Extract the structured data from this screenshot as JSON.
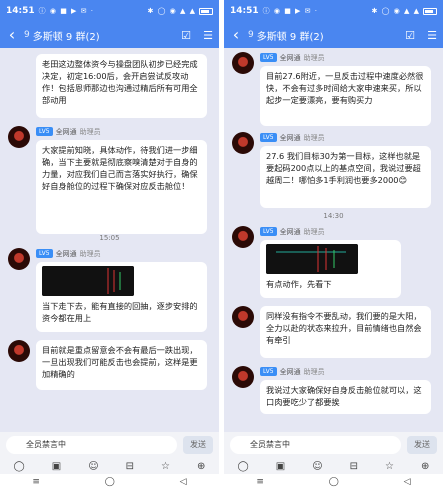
{
  "colors": {
    "header": "#4a86f0",
    "chat_bg": "#e5e7f3",
    "badge": "#3a8ef6"
  },
  "left": {
    "status": {
      "time": "14:51",
      "notif_icons": "ⓘ ◉ ■ ▶ ✉ ·",
      "sys_icons": "✱ ◯ ◉ ▲ ▲"
    },
    "header": {
      "tag": "9",
      "title": "多斯顿 9 群(2)"
    },
    "messages": [
      {
        "text": "老田这边整体资今与操盘团队初步已经完成决定，初定16:00后，会开启尝试反攻动作！包括恩师那边也沟通过精后所有可用全部动用"
      },
      {
        "badge": "LV5",
        "sender": "全网通",
        "role": "助理员",
        "text": "大家提前知晓，具体动作，待我们进一步细确，当下主要就是彻底察嗅清楚对于自身的力量，对应我们自己而言落实好执行，确保好自身舱位的过程下确保对应反击舱位！"
      },
      {
        "time": "15:05"
      },
      {
        "badge": "LV5",
        "sender": "全网通",
        "role": "助理员",
        "text": "当下走下去，能有直接的回抽，逐步安排的资今都在用上"
      },
      {
        "text": "目前就是重点留意会不会有最后一跌出现，一旦出现我们可能反击也会提前，这样是更加精确的"
      }
    ],
    "input": {
      "placeholder": "全员禁言中",
      "send": "发送"
    },
    "bottom_icons": [
      "◯",
      "▣",
      "☺",
      "⊟",
      "☆",
      "⊕"
    ],
    "nav": [
      "≡",
      "◯",
      "◁"
    ]
  },
  "right": {
    "status": {
      "time": "14:51",
      "notif_icons": "ⓘ ◉ ■ ▶ ✉ ·",
      "sys_icons": "✱ ◯ ◉ ▲ ▲"
    },
    "header": {
      "tag": "9",
      "title": "多斯顿 9 群(2)"
    },
    "messages": [
      {
        "badge": "LV5",
        "sender": "全网通",
        "role": "助理员",
        "text": "目前27.6附近，一旦反击过程中速度必然很快，不会有过多时间给大家申速来买，所以起步一定要漂亮，要有购买力"
      },
      {
        "badge": "LV5",
        "sender": "全网通",
        "role": "助理员",
        "text": "27.6 我们目标30为第一目标，这样也就是要起码200点以上的基点空间，我说过要超越周二！哪怕多1手利润也要多2000😊"
      },
      {
        "time": "14:30"
      },
      {
        "badge": "LV5",
        "sender": "全网通",
        "role": "助理员",
        "text": "有点动作，先看下"
      },
      {
        "text": "同样没有指令不要乱动，我们要的是大阳，全力以赴的状态来拉升，目前情绪也自然会有牵引"
      },
      {
        "badge": "LV5",
        "sender": "全网通",
        "role": "助理员",
        "text": "我说过大家确保好自身反击舱位就可以，这口肉要吃少了都要挨"
      }
    ],
    "input": {
      "placeholder": "全员禁言中",
      "send": "发送"
    },
    "bottom_icons": [
      "◯",
      "▣",
      "☺",
      "⊟",
      "☆",
      "⊕"
    ],
    "nav": [
      "≡",
      "◯",
      "◁"
    ]
  }
}
